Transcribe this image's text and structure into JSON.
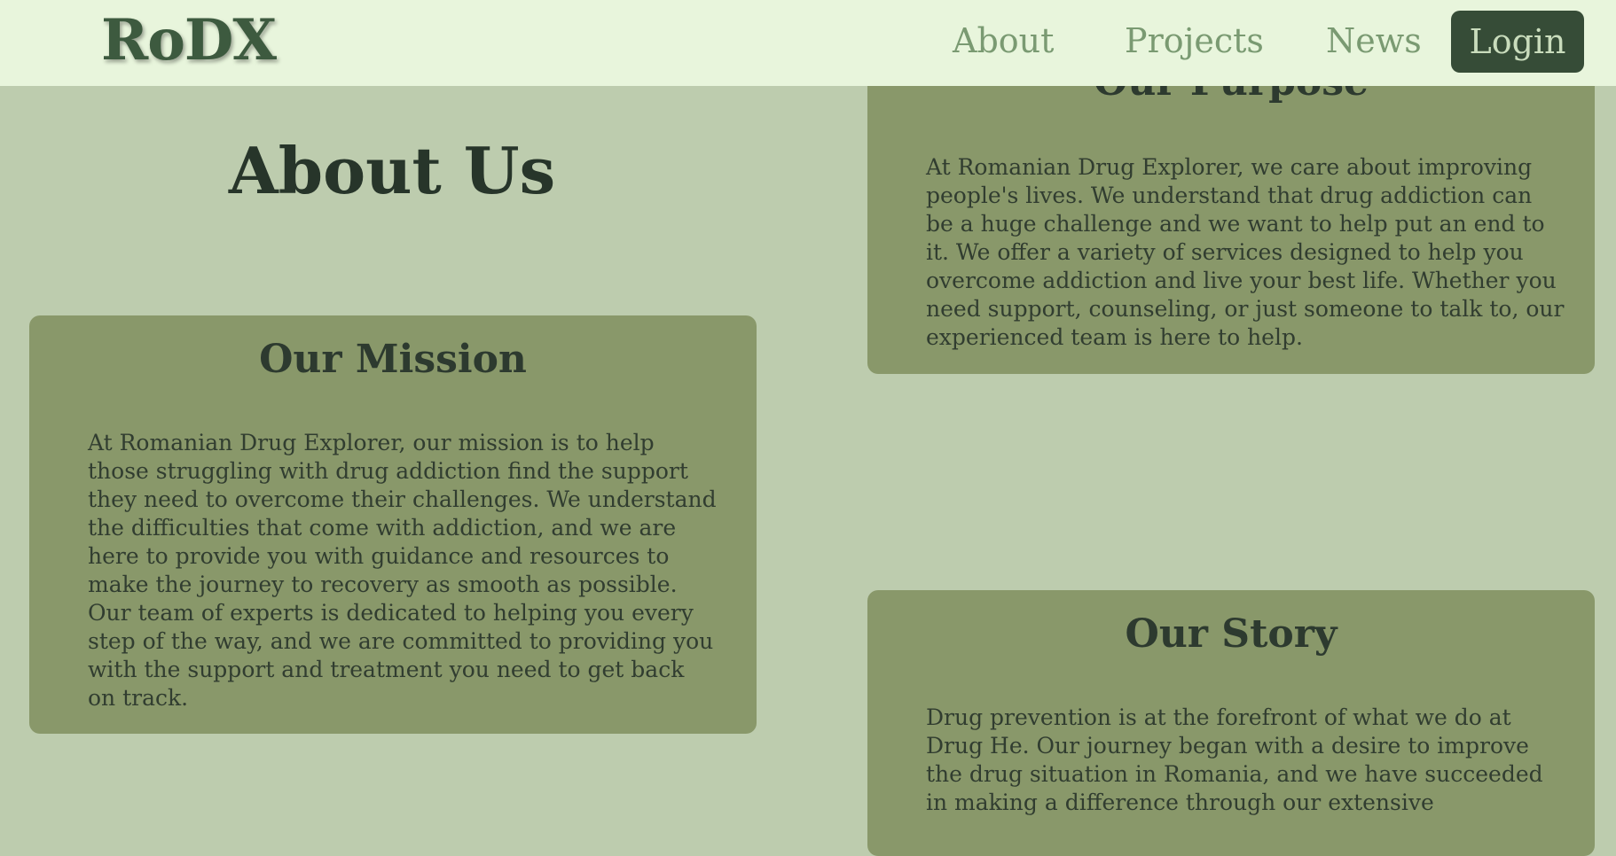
{
  "nav": {
    "brand": "RoDX",
    "links": [
      "About",
      "Projects",
      "News"
    ],
    "login_label": "Login"
  },
  "page": {
    "title": "About Us"
  },
  "sections": {
    "mission": {
      "heading": "Our Mission",
      "body": "At Romanian Drug Explorer, our mission is to help those struggling with drug addiction find the support they need to overcome their challenges. We understand the difficulties that come with addiction, and we are here to provide you with guidance and resources to make the journey to recovery as smooth as possible. Our team of experts is dedicated to helping you every step of the way, and we are committed to providing you with the support and treatment you need to get back on track."
    },
    "purpose": {
      "heading": "Our Purpose",
      "body": "At Romanian Drug Explorer, we care about improving people's lives. We understand that drug addiction can be a huge challenge and we want to help put an end to it. We offer a variety of services designed to help you overcome addiction and live your best life. Whether you need support, counseling, or just someone to talk to, our experienced team is here to help."
    },
    "story": {
      "heading": "Our Story",
      "body": "Drug prevention is at the forefront of what we do at Drug He. Our journey began with a desire to improve the drug situation in Romania, and we have succeeded in making a difference through our extensive"
    }
  },
  "colors": {
    "background": "#bdccae",
    "navbar": "#e8f5dc",
    "card": "#89986a",
    "login_button": "#364c37",
    "brand": "#3d5a3f",
    "nav_link": "#7a9a72"
  }
}
